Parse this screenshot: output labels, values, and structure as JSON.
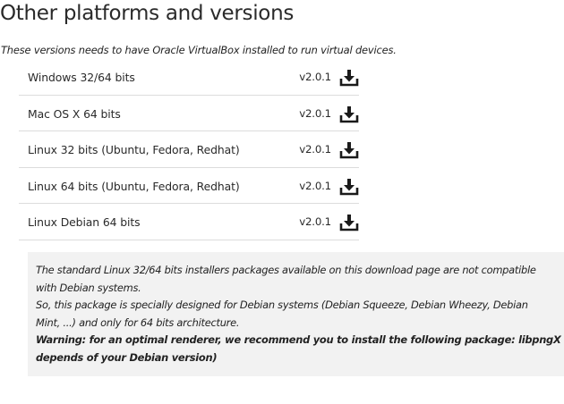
{
  "page": {
    "title": "Other platforms and versions",
    "intro": "These versions needs to have Oracle VirtualBox installed to run virtual devices."
  },
  "platforms": [
    {
      "name": "Windows 32/64 bits",
      "version": "v2.0.1",
      "icon": "download-icon"
    },
    {
      "name": "Mac OS X 64 bits",
      "version": "v2.0.1",
      "icon": "download-icon"
    },
    {
      "name": "Linux 32 bits (Ubuntu, Fedora, Redhat)",
      "version": "v2.0.1",
      "icon": "download-icon"
    },
    {
      "name": "Linux 64 bits (Ubuntu, Fedora, Redhat)",
      "version": "v2.0.1",
      "icon": "download-icon"
    },
    {
      "name": "Linux Debian 64 bits",
      "version": "v2.0.1",
      "icon": "download-icon"
    }
  ],
  "note": {
    "line1": "The standard Linux 32/64 bits installers packages available on this download page are not compatible",
    "line2": "with Debian systems.",
    "line3": "So, this package is specially designed for Debian systems (Debian Squeeze, Debian Wheezy, Debian",
    "line4": "Mint, ...) and only for 64 bits architecture.",
    "warning1": "Warning: for an optimal renderer, we recommend you to install the following package: libpngX (X",
    "warning2": "depends of your Debian version)"
  },
  "colors": {
    "text": "#222222",
    "divider": "#dcdcdc",
    "note_background": "#f2f2f2"
  }
}
